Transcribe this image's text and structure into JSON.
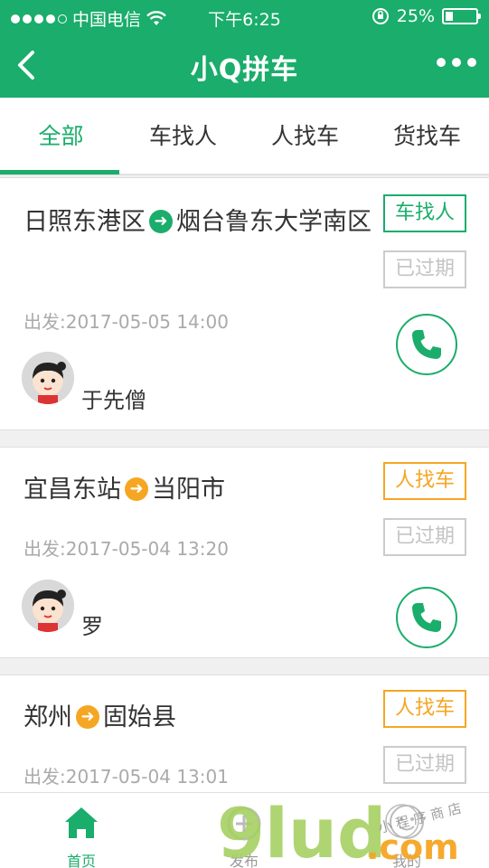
{
  "status_bar": {
    "carrier": "中国电信",
    "time": "下午6:25",
    "battery": "25%",
    "battery_level": 0.25,
    "icons": [
      "signal-dots",
      "wifi-icon",
      "rotation-lock-icon",
      "battery-icon"
    ]
  },
  "nav": {
    "title": "小Q拼车",
    "back_icon": "chevron-left-icon",
    "more_icon": "more-dots-icon"
  },
  "tabs": [
    {
      "label": "全部",
      "active": true
    },
    {
      "label": "车找人",
      "active": false
    },
    {
      "label": "人找车",
      "active": false
    },
    {
      "label": "货找车",
      "active": false
    }
  ],
  "trips": [
    {
      "from": "日照东港区",
      "to": "烟台鲁东大学南区",
      "type": "车找人",
      "status": "已过期",
      "depart": "出发:2017-05-05 14:00",
      "name": "于先僧",
      "accent": "#1aad6b"
    },
    {
      "from": "宜昌东站",
      "to": "当阳市",
      "type": "人找车",
      "status": "已过期",
      "depart": "出发:2017-05-04 13:20",
      "name": "罗",
      "accent": "#f5a623"
    },
    {
      "from": "郑州",
      "to": "固始县",
      "type": "人找车",
      "status": "已过期",
      "depart": "出发:2017-05-04 13:01",
      "name": "",
      "accent": "#f5a623"
    }
  ],
  "tabbar": [
    {
      "label": "首页",
      "icon": "home-icon",
      "active": true
    },
    {
      "label": "发布",
      "icon": "publish-icon",
      "active": false
    },
    {
      "label": "我的",
      "icon": "profile-icon",
      "active": false
    }
  ],
  "watermark": "9lud.com 小程序商店",
  "colors": {
    "primary": "#1aad6b",
    "orange": "#f5a623",
    "muted": "#aaaaaa"
  }
}
